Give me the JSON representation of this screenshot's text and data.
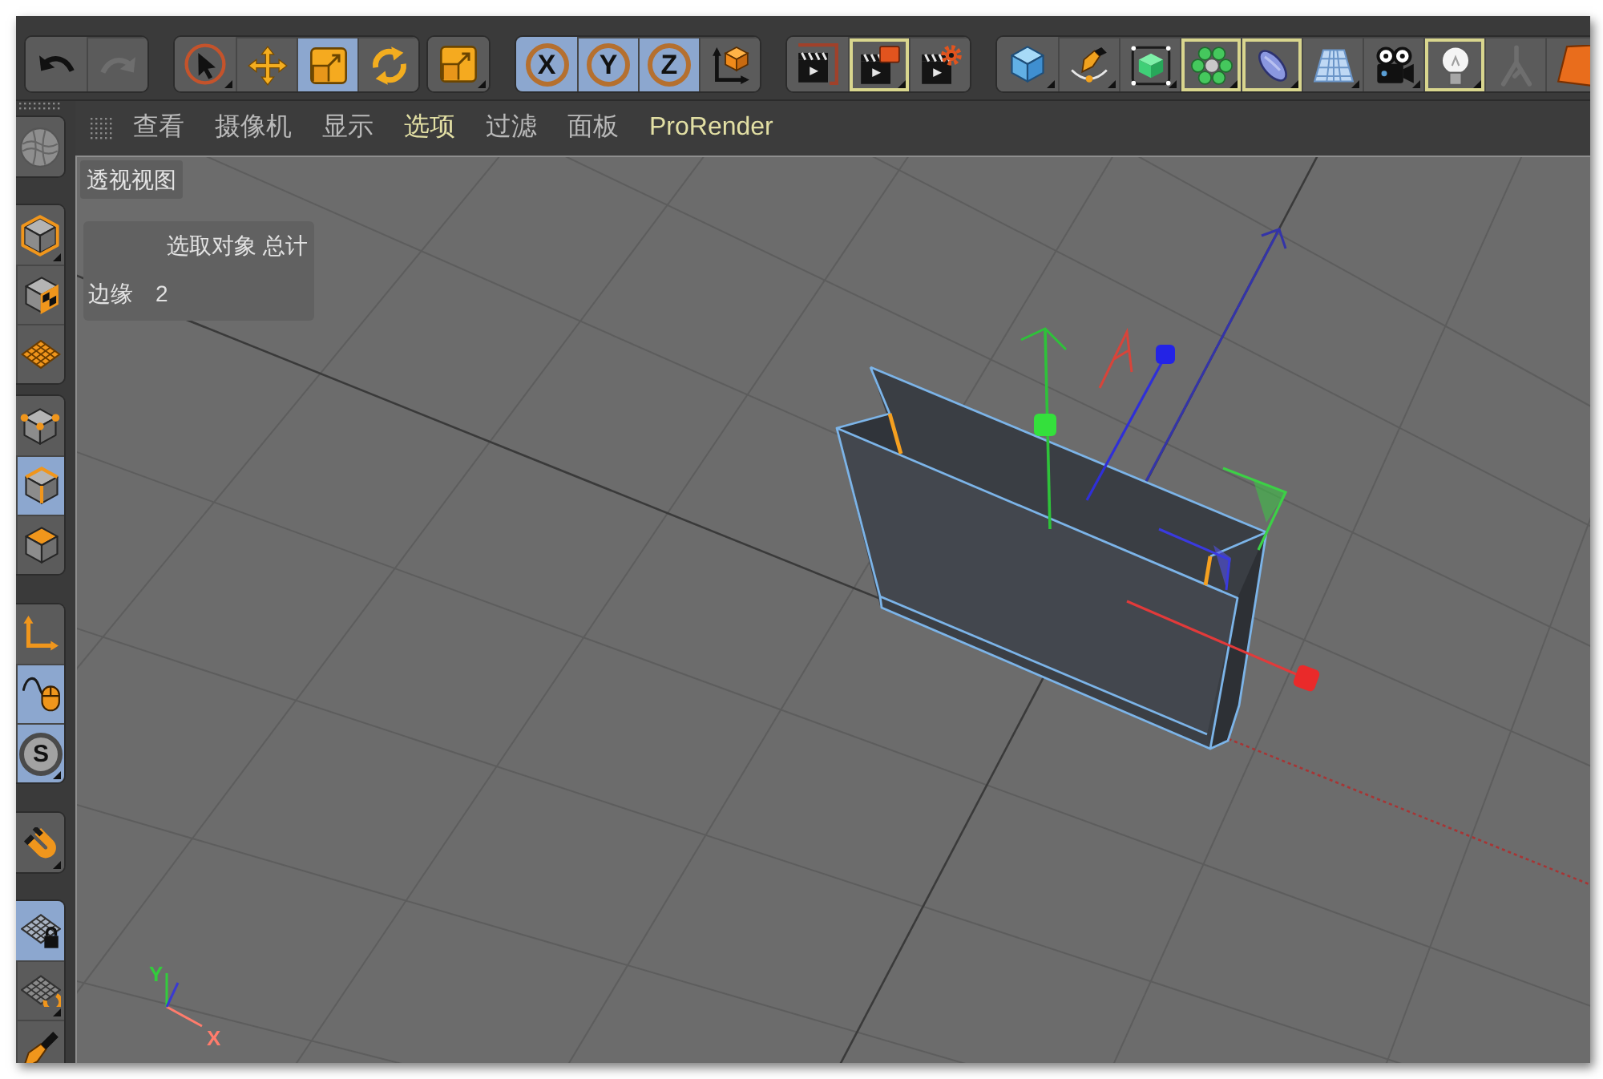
{
  "toolbar": {
    "groups": [
      {
        "tools": [
          {
            "kind": "undo",
            "selected": false,
            "highlighted": false,
            "disabled": false,
            "submenu": false
          },
          {
            "kind": "redo",
            "selected": false,
            "highlighted": false,
            "disabled": true,
            "submenu": false
          }
        ]
      },
      {
        "tools": [
          {
            "kind": "select",
            "selected": false,
            "highlighted": false,
            "disabled": false,
            "submenu": true
          },
          {
            "kind": "move",
            "selected": false,
            "highlighted": false,
            "disabled": false,
            "submenu": false
          },
          {
            "kind": "scale",
            "selected": true,
            "highlighted": false,
            "disabled": false,
            "submenu": false
          },
          {
            "kind": "rotate",
            "selected": false,
            "highlighted": false,
            "disabled": false,
            "submenu": false
          }
        ]
      },
      {
        "tools": [
          {
            "kind": "scale",
            "selected": false,
            "highlighted": false,
            "disabled": false,
            "submenu": true
          }
        ]
      },
      {
        "tools": [
          {
            "kind": "axis",
            "label": "X",
            "selected": true,
            "highlighted": false,
            "disabled": false,
            "submenu": false
          },
          {
            "kind": "axis",
            "label": "Y",
            "selected": true,
            "highlighted": false,
            "disabled": false,
            "submenu": false
          },
          {
            "kind": "axis",
            "label": "Z",
            "selected": true,
            "highlighted": false,
            "disabled": false,
            "submenu": false
          },
          {
            "kind": "coordinates",
            "selected": false,
            "highlighted": false,
            "disabled": false,
            "submenu": false
          }
        ]
      },
      {
        "tools": [
          {
            "kind": "renderview",
            "selected": false,
            "highlighted": false,
            "disabled": false,
            "submenu": false
          },
          {
            "kind": "renderpicture",
            "selected": false,
            "highlighted": true,
            "disabled": false,
            "submenu": true
          },
          {
            "kind": "rendersettings",
            "selected": false,
            "highlighted": false,
            "disabled": false,
            "submenu": false
          }
        ]
      },
      {
        "tools": [
          {
            "kind": "cube",
            "selected": false,
            "highlighted": false,
            "disabled": false,
            "submenu": true
          },
          {
            "kind": "pen",
            "selected": false,
            "highlighted": false,
            "disabled": false,
            "submenu": true
          },
          {
            "kind": "subdivision",
            "selected": false,
            "highlighted": false,
            "disabled": false,
            "submenu": true
          },
          {
            "kind": "cloner",
            "selected": false,
            "highlighted": true,
            "disabled": false,
            "submenu": true
          },
          {
            "kind": "deformer",
            "selected": false,
            "highlighted": true,
            "disabled": false,
            "submenu": true
          },
          {
            "kind": "floor",
            "selected": false,
            "highlighted": false,
            "disabled": false,
            "submenu": true
          },
          {
            "kind": "camera",
            "selected": false,
            "highlighted": false,
            "disabled": false,
            "submenu": true
          },
          {
            "kind": "light",
            "selected": false,
            "highlighted": true,
            "disabled": false,
            "submenu": true
          },
          {
            "kind": "character",
            "selected": false,
            "highlighted": false,
            "disabled": true,
            "submenu": false
          },
          {
            "kind": "shape",
            "selected": false,
            "highlighted": false,
            "disabled": false,
            "submenu": false
          }
        ]
      }
    ]
  },
  "menu_bar": {
    "items": [
      {
        "label": "查看",
        "highlighted": false
      },
      {
        "label": "摄像机",
        "highlighted": false
      },
      {
        "label": "显示",
        "highlighted": false
      },
      {
        "label": "选项",
        "highlighted": true
      },
      {
        "label": "过滤",
        "highlighted": false
      },
      {
        "label": "面板",
        "highlighted": false
      },
      {
        "label": "ProRender",
        "highlighted": true
      }
    ]
  },
  "left_toolbar": {
    "groups": [
      {
        "tools": [
          {
            "kind": "sculpt",
            "selected": false,
            "highlighted": false,
            "disabled": false,
            "submenu": false
          }
        ]
      },
      {
        "tools": [
          {
            "kind": "model",
            "selected": false,
            "highlighted": false,
            "disabled": false,
            "submenu": true
          },
          {
            "kind": "texture",
            "selected": false,
            "highlighted": false,
            "disabled": false,
            "submenu": false
          },
          {
            "kind": "workplane",
            "selected": false,
            "highlighted": false,
            "disabled": false,
            "submenu": false
          }
        ]
      },
      {
        "tools": [
          {
            "kind": "points",
            "selected": false,
            "highlighted": false,
            "disabled": false,
            "submenu": false
          },
          {
            "kind": "edges",
            "selected": true,
            "highlighted": false,
            "disabled": false,
            "submenu": false
          },
          {
            "kind": "polygons",
            "selected": false,
            "highlighted": false,
            "disabled": false,
            "submenu": false
          }
        ]
      },
      {
        "tools": [
          {
            "kind": "axismode",
            "selected": false,
            "highlighted": false,
            "disabled": false,
            "submenu": false
          },
          {
            "kind": "tweak",
            "selected": true,
            "highlighted": false,
            "disabled": false,
            "submenu": false
          },
          {
            "kind": "solo",
            "label": "S",
            "selected": true,
            "highlighted": false,
            "disabled": false,
            "submenu": true
          }
        ]
      },
      {
        "tools": [
          {
            "kind": "snap",
            "selected": false,
            "highlighted": false,
            "disabled": false,
            "submenu": true
          }
        ]
      },
      {
        "tools": [
          {
            "kind": "lockplane",
            "selected": true,
            "highlighted": false,
            "disabled": false,
            "submenu": false
          },
          {
            "kind": "planar",
            "selected": false,
            "highlighted": false,
            "disabled": false,
            "submenu": true
          },
          {
            "kind": "pen",
            "selected": false,
            "highlighted": false,
            "disabled": false,
            "submenu": false
          }
        ]
      }
    ]
  },
  "viewport": {
    "title": "透视视图",
    "info_panel": {
      "header": "选取对象 总计",
      "rows": [
        {
          "label": "边缘",
          "value": "2"
        }
      ]
    },
    "axis_labels": [
      {
        "label": "Y",
        "color": "#33cc3c"
      },
      {
        "label": "X",
        "color": "#ff7c6c"
      }
    ]
  }
}
